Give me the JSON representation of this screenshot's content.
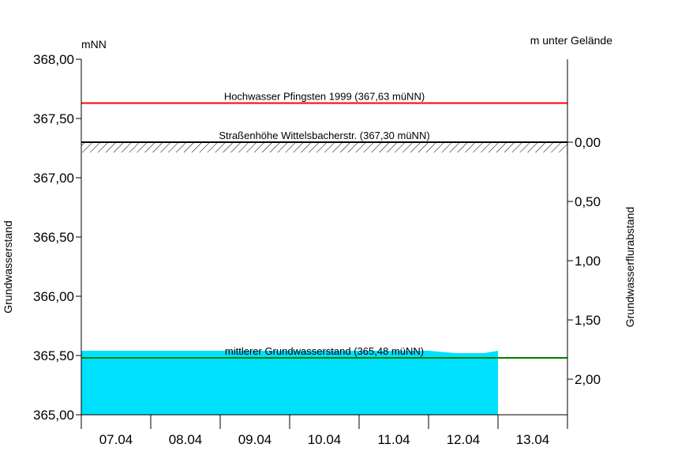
{
  "chart_data": {
    "type": "area",
    "title": "",
    "y_unit_left": "mNN",
    "y_unit_right": "m unter Gelände",
    "ylabel_left": "Grundwasserstand",
    "ylabel_right": "Grundwasserflurabstand",
    "ylim": [
      365.0,
      368.0
    ],
    "y_ticks_left": [
      "368,00",
      "367,50",
      "367,00",
      "366,50",
      "366,00",
      "365,50",
      "365,00"
    ],
    "y_ticks_left_values": [
      368.0,
      367.5,
      367.0,
      366.5,
      366.0,
      365.5,
      365.0
    ],
    "y_ticks_right": [
      "0,00",
      "0,50",
      "1,00",
      "1,50",
      "2,00"
    ],
    "y_ticks_right_values": [
      0.0,
      0.5,
      1.0,
      1.5,
      2.0
    ],
    "x_categories": [
      "07.04",
      "08.04",
      "09.04",
      "10.04",
      "11.04",
      "12.04",
      "13.04"
    ],
    "xlim": [
      0,
      7
    ],
    "area_color": "#00e0ff",
    "series": [
      {
        "x": [
          0.0,
          0.5,
          1.0,
          1.5,
          2.0,
          2.5,
          3.0,
          3.5,
          4.0,
          4.5,
          5.0,
          5.2,
          5.4,
          5.6,
          5.8,
          6.0
        ],
        "values": [
          365.54,
          365.54,
          365.54,
          365.54,
          365.54,
          365.54,
          365.54,
          365.54,
          365.54,
          365.54,
          365.54,
          365.53,
          365.52,
          365.52,
          365.52,
          365.54
        ]
      }
    ],
    "reference_lines": [
      {
        "label": "Hochwasser Pfingsten 1999 (367,63 müNN)",
        "value": 367.63,
        "color": "#ff0000"
      },
      {
        "label": "Straßenhöhe Wittelsbacherstr. (367,30 müNN)",
        "value": 367.3,
        "color": "#000000"
      },
      {
        "label": "mittlerer Grundwasserstand (365,48 müNN)",
        "value": 365.48,
        "color": "#008000"
      }
    ],
    "ground_level": 367.3
  }
}
